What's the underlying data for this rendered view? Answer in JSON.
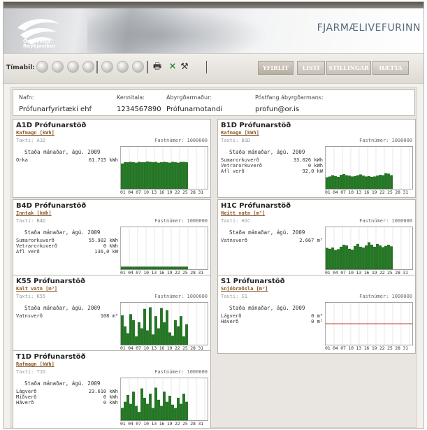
{
  "window": {
    "title": "FJARMÆLIVEFURINN"
  },
  "logo": {
    "text_line1": "Orkuveita",
    "text_line2": "Reykjavíkur"
  },
  "toolbar": {
    "timabil_label": "Tímabil:",
    "nav_buttons": [
      "YFIRLIT",
      "LISTI",
      "STILLINGAR",
      "HÆTTA"
    ],
    "active": "YFIRLIT",
    "icons": [
      "print-icon",
      "excel-icon",
      "tools-icon"
    ]
  },
  "info": {
    "nafn_label": "Nafn:",
    "nafn": "Prófunarfyrirtæki ehf",
    "kennitala_label": "Kennitala:",
    "kennitala": "1234567890",
    "abyrgdarmadur_label": "Ábyrgðarmaður:",
    "abyrgdarmadur": "Prófunarnotandi",
    "postfang_label": "Póstfang ábyrgðarmans:",
    "postfang": "profun@or.is"
  },
  "common": {
    "stada": "Staða mánaðar, ágú. 2009",
    "fastnumer": "Fastnúmer: 1000000",
    "ticks": "01 04 07 10 13 16 19 22 25 28 31"
  },
  "panels": [
    {
      "title": "A1D Prófunarstöð",
      "unit": "Rafmagn [kWh]",
      "taxti": "Taxti: A1D",
      "rows": [
        {
          "k": "Orka",
          "v": "61.715 kWh"
        }
      ],
      "accent": "#1e7a1e",
      "chart_data": {
        "type": "bar",
        "values": [
          62,
          65,
          65,
          66,
          65,
          64,
          66,
          65,
          65,
          67,
          66,
          65,
          66,
          64,
          65,
          66,
          65,
          64,
          66,
          65,
          64,
          66,
          66,
          65,
          0,
          0,
          0,
          0,
          0,
          0,
          0
        ]
      }
    },
    {
      "title": "B1D Prófunarstöð",
      "unit": "Rafmagn [kWh]",
      "taxti": "Taxti: B1D",
      "rows": [
        {
          "k": "Sumarorkuverð",
          "v": "33.026 kWh"
        },
        {
          "k": "Vetrarorkuverð",
          "v": "0 kWh"
        },
        {
          "k": "Afl verð",
          "v": "92,0 kW"
        }
      ],
      "accent": "#1e7a1e",
      "chart_data": {
        "type": "bar",
        "values": [
          28,
          30,
          33,
          31,
          29,
          34,
          36,
          33,
          32,
          30,
          31,
          33,
          35,
          32,
          30,
          31,
          29,
          30,
          32,
          34,
          33,
          38,
          37,
          33,
          0,
          0,
          0,
          0,
          0,
          0,
          0
        ]
      }
    },
    {
      "title": "B4D Prófunarstöð",
      "unit": "Inntak [kWh]",
      "taxti": "Taxti: B4D",
      "rows": [
        {
          "k": "Sumarorkuverð",
          "v": "55.902 kWh"
        },
        {
          "k": "Vetrarorkuverð",
          "v": "0 kWh"
        },
        {
          "k": "Afl verð",
          "v": "136,0 kW"
        }
      ],
      "accent": "#1e7a1e",
      "chart_data": {
        "type": "bar",
        "values": [
          6,
          6,
          6,
          6,
          6,
          6,
          6,
          6,
          6,
          6,
          6,
          6,
          6,
          6,
          6,
          6,
          6,
          6,
          6,
          6,
          6,
          6,
          6,
          6,
          0,
          0,
          0,
          0,
          0,
          0,
          0
        ]
      }
    },
    {
      "title": "H1C Prófunarstöð",
      "unit": "Heitt vatn [m³]",
      "taxti": "Taxti: H1C",
      "rows": [
        {
          "k": "Vatnsverð",
          "v": "2.667 m³"
        }
      ],
      "accent": "#1e7a1e",
      "chart_data": {
        "type": "bar",
        "values": [
          52,
          50,
          53,
          47,
          49,
          55,
          60,
          58,
          50,
          48,
          57,
          62,
          55,
          53,
          58,
          66,
          60,
          55,
          62,
          58,
          54,
          57,
          60,
          56,
          0,
          0,
          0,
          0,
          0,
          0,
          0
        ]
      }
    },
    {
      "title": "K55 Prófunarstöð",
      "unit": "Kalt vatn [m³]",
      "taxti": "Taxti: K55",
      "rows": [
        {
          "k": "Vatnsverð",
          "v": "108 m³"
        }
      ],
      "accent": "#1e7a1e",
      "chart_data": {
        "type": "bar",
        "values": [
          72,
          45,
          28,
          75,
          60,
          20,
          55,
          40,
          88,
          35,
          92,
          25,
          70,
          40,
          90,
          55,
          85,
          30,
          22,
          60,
          45,
          70,
          20,
          50,
          0,
          0,
          0,
          0,
          0,
          0,
          0
        ]
      }
    },
    {
      "title": "S1 Prófunarstöð",
      "unit": "Snjóbræðsla [m³]",
      "taxti": "Taxti: S1",
      "rows": [
        {
          "k": "Lágverð",
          "v": "0 m³"
        },
        {
          "k": "Háverð",
          "v": "0 m³"
        }
      ],
      "accent": "#c0392b",
      "chart_data": {
        "type": "line",
        "values": [
          0,
          0,
          0,
          0,
          0,
          0,
          0,
          0,
          0,
          0,
          0,
          0,
          0,
          0,
          0,
          0,
          0,
          0,
          0,
          0,
          0,
          0,
          0,
          0,
          0,
          0,
          0,
          0,
          0,
          0,
          0
        ]
      }
    },
    {
      "title": "T1D Prófunarstöð",
      "unit": "Rafmagn [kWh]",
      "taxti": "Taxti: T1D",
      "rows": [
        {
          "k": "Lágverð",
          "v": "23.610 kWh"
        },
        {
          "k": "Miðverð",
          "v": "0 kWh"
        },
        {
          "k": "Háverð",
          "v": "0 kWh"
        }
      ],
      "accent": "#1e7a1e",
      "chart_data": {
        "type": "bar",
        "values": [
          30,
          45,
          62,
          40,
          70,
          35,
          20,
          78,
          55,
          40,
          65,
          30,
          80,
          50,
          35,
          70,
          45,
          60,
          38,
          30,
          55,
          40,
          65,
          45,
          0,
          0,
          0,
          0,
          0,
          0,
          0
        ]
      }
    }
  ]
}
